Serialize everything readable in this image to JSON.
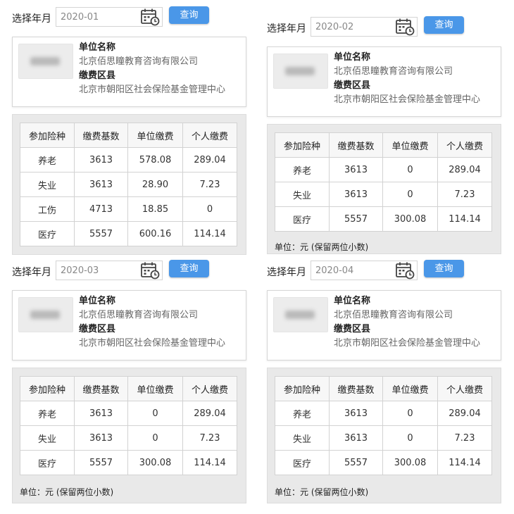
{
  "common": {
    "month_label": "选择年月",
    "query_label": "查询",
    "unit_name_label": "单位名称",
    "unit_name": "北京佰思瞳教育咨询有限公司",
    "district_label": "缴费区县",
    "district": "北京市朝阳区社会保险基金管理中心",
    "headers": [
      "参加险种",
      "缴费基数",
      "单位缴费",
      "个人缴费"
    ],
    "note": "单位：元 (保留两位小数)"
  },
  "panels": [
    {
      "month": "2020-01",
      "rows": [
        {
          "type": "养老",
          "base": "3613",
          "employer": "578.08",
          "personal": "289.04"
        },
        {
          "type": "失业",
          "base": "3613",
          "employer": "28.90",
          "personal": "7.23"
        },
        {
          "type": "工伤",
          "base": "4713",
          "employer": "18.85",
          "personal": "0"
        },
        {
          "type": "医疗",
          "base": "5557",
          "employer": "600.16",
          "personal": "114.14"
        }
      ]
    },
    {
      "month": "2020-02",
      "rows": [
        {
          "type": "养老",
          "base": "3613",
          "employer": "0",
          "personal": "289.04"
        },
        {
          "type": "失业",
          "base": "3613",
          "employer": "0",
          "personal": "7.23"
        },
        {
          "type": "医疗",
          "base": "5557",
          "employer": "300.08",
          "personal": "114.14"
        }
      ]
    },
    {
      "month": "2020-03",
      "rows": [
        {
          "type": "养老",
          "base": "3613",
          "employer": "0",
          "personal": "289.04"
        },
        {
          "type": "失业",
          "base": "3613",
          "employer": "0",
          "personal": "7.23"
        },
        {
          "type": "医疗",
          "base": "5557",
          "employer": "300.08",
          "personal": "114.14"
        }
      ]
    },
    {
      "month": "2020-04",
      "rows": [
        {
          "type": "养老",
          "base": "3613",
          "employer": "0",
          "personal": "289.04"
        },
        {
          "type": "失业",
          "base": "3613",
          "employer": "0",
          "personal": "7.23"
        },
        {
          "type": "医疗",
          "base": "5557",
          "employer": "300.08",
          "personal": "114.14"
        }
      ]
    }
  ]
}
